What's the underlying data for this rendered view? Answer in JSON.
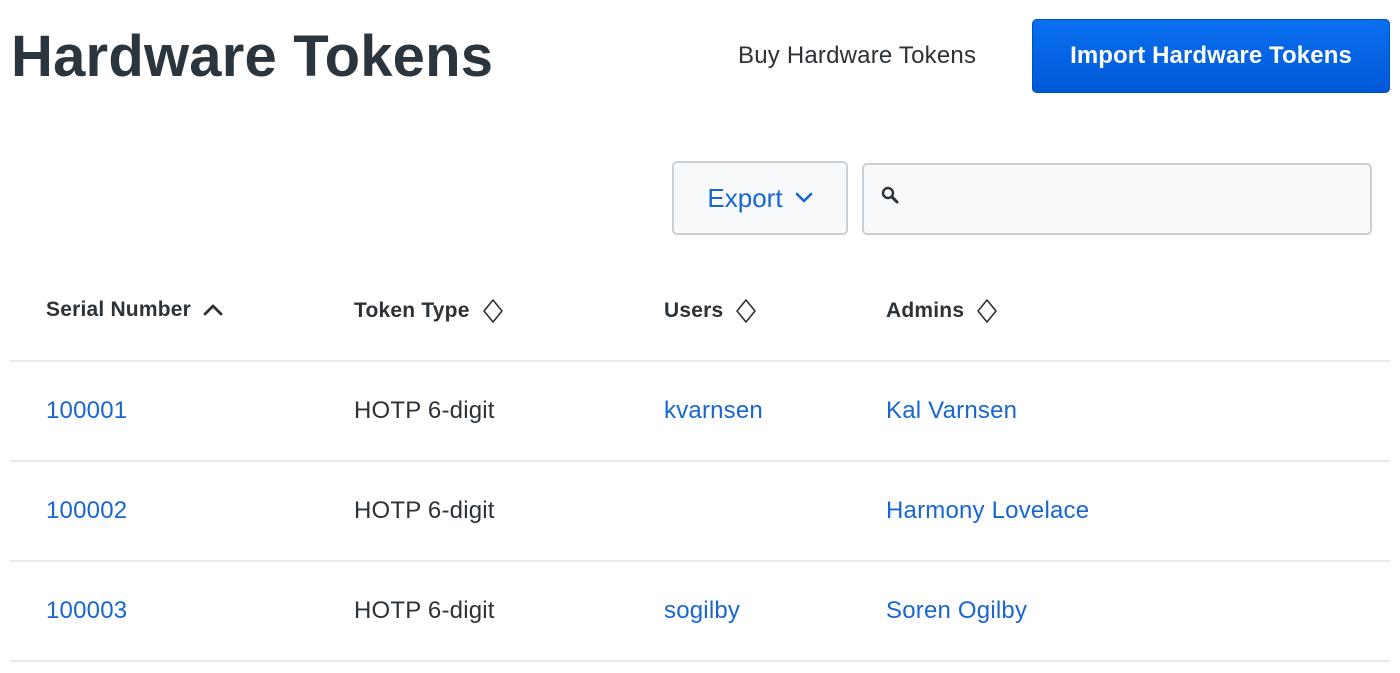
{
  "header": {
    "title": "Hardware Tokens",
    "buy_link": "Buy Hardware Tokens",
    "import_button": "Import Hardware Tokens"
  },
  "toolbar": {
    "export_label": "Export",
    "export_icon": "chevron-down-icon",
    "search_icon": "search-icon",
    "search_value": "",
    "search_placeholder": ""
  },
  "table": {
    "columns": [
      {
        "label": "Serial Number",
        "sort": "ascending",
        "sort_icon": "sort-ascending-icon"
      },
      {
        "label": "Token Type",
        "sort": "unsorted",
        "sort_icon": "sort-unsorted-icon"
      },
      {
        "label": "Users",
        "sort": "unsorted",
        "sort_icon": "sort-unsorted-icon"
      },
      {
        "label": "Admins",
        "sort": "unsorted",
        "sort_icon": "sort-unsorted-icon"
      }
    ],
    "rows": [
      {
        "serial": "100001",
        "type": "HOTP 6-digit",
        "user": "kvarnsen",
        "admin": "Kal Varnsen"
      },
      {
        "serial": "100002",
        "type": "HOTP 6-digit",
        "user": "",
        "admin": "Harmony Lovelace"
      },
      {
        "serial": "100003",
        "type": "HOTP 6-digit",
        "user": "sogilby",
        "admin": "Soren Ogilby"
      }
    ]
  },
  "colors": {
    "primary": "#0a6ff0",
    "link": "#1766d2",
    "text": "#2b3238",
    "divider": "#e6eaee"
  }
}
